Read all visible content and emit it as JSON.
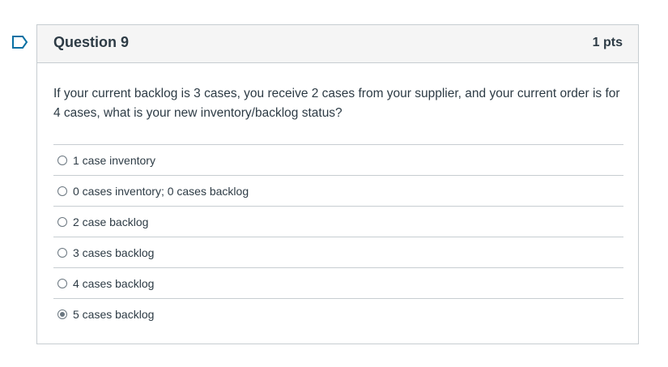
{
  "question": {
    "title": "Question 9",
    "points": "1 pts",
    "text": "If your current backlog is 3 cases, you receive 2 cases from your supplier, and your current order is for 4 cases, what is your new inventory/backlog status?",
    "flag_icon": "bookmark-flag-icon",
    "accent_color": "#0770a3"
  },
  "answers": [
    {
      "label": "1 case inventory",
      "selected": false
    },
    {
      "label": "0 cases inventory; 0 cases backlog",
      "selected": false
    },
    {
      "label": "2 case backlog",
      "selected": false
    },
    {
      "label": "3 cases backlog",
      "selected": false
    },
    {
      "label": "4 cases backlog",
      "selected": false
    },
    {
      "label": "5 cases backlog",
      "selected": true
    }
  ]
}
